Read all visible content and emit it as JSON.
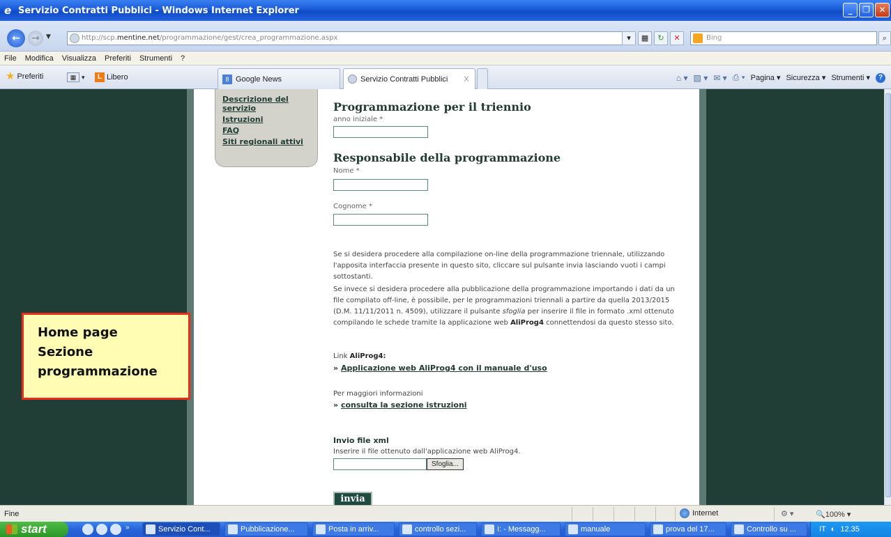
{
  "window": {
    "title": "Servizio Contratti Pubblici - Windows Internet Explorer"
  },
  "address": {
    "url_prefix": "http://scp.",
    "url_domain": "mentine.net",
    "url_path": "/programmazione/gest/crea_programmazione.aspx",
    "search_placeholder": "Bing"
  },
  "menu": [
    "File",
    "Modifica",
    "Visualizza",
    "Preferiti",
    "Strumenti",
    "?"
  ],
  "favorites": {
    "preferiti": "Preferiti",
    "libero": "Libero"
  },
  "tabs": [
    {
      "label": "Google News"
    },
    {
      "label": "Servizio Contratti Pubblici",
      "close": "X"
    }
  ],
  "commandbar": {
    "pagina": "Pagina",
    "sicurezza": "Sicurezza",
    "strumenti": "Strumenti"
  },
  "sidenav": {
    "items": [
      "Descrizione del servizio",
      "Istruzioni",
      "FAQ",
      "Siti regionali attivi"
    ]
  },
  "form": {
    "heading1": "Programmazione per il triennio",
    "anno_label": "anno iniziale *",
    "heading2": "Responsabile della programmazione",
    "nome_label": "Nome *",
    "cognome_label": "Cognome *",
    "para1": "Se si desidera procedere alla compilazione on-line della programmazione triennale, utilizzando l'apposita interfaccia presente in questo sito, cliccare sul pulsante invia lasciando vuoti i campi sottostanti.",
    "para2_a": "Se invece si desidera procedere alla pubblicazione della programmazione importando i dati da un file compilato off-line, è possibile, per le programmazioni triennali a partire da quella 2013/2015 (D.M. 11/11/2011 n. 4509), utilizzare il pulsante ",
    "para2_sfoglia": "sfoglia",
    "para2_b": " per inserire il file in formato .xml ottenuto compilando le schede tramite la applicazione web ",
    "para2_aliprog": "AliProg4",
    "para2_c": " connettendosi da questo stesso sito.",
    "link_label_prefix": "Link ",
    "link_label_bold": "AliProg4:",
    "link_aliprog": "Applicazione web AliProg4 con il manuale d'uso",
    "info_label": "Per maggiori informazioni",
    "link_istruzioni": "consulta la sezione istruzioni",
    "link_marker": "»",
    "xml_title": "Invio file xml",
    "xml_desc": "Inserire il file ottenuto dall'applicazione web AliProg4.",
    "browse_label": "Sfoglia...",
    "submit_label": "invia"
  },
  "callout": {
    "line1": "Home page",
    "line2": "Sezione",
    "line3": "programmazione"
  },
  "status": {
    "text": "Fine",
    "zone": "Internet",
    "zoom": "100%"
  },
  "taskbar": {
    "start": "start",
    "tasks": [
      "Servizio Cont...",
      "Pubblicazione...",
      "Posta in arriv...",
      "controllo sezi...",
      "I: - Messagg...",
      "manuale",
      "prova del 17...",
      "Controllo su ..."
    ],
    "lang": "IT",
    "time": "12.35"
  }
}
